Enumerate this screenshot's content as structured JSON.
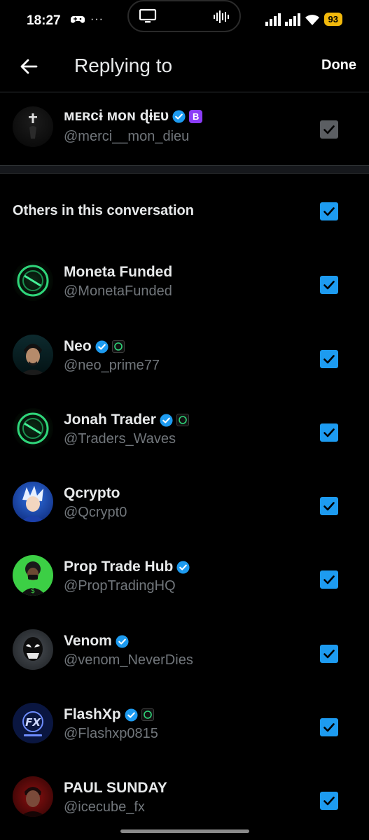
{
  "status_bar": {
    "time": "18:27",
    "dots": "···",
    "battery": "93"
  },
  "header": {
    "title": "Replying to",
    "done_label": "Done"
  },
  "primary": {
    "name": "ᴍᴇʀᴄɨ ᴍᴏɴ ɖɨᴇᴜ",
    "handle": "@merci__mon_dieu",
    "badge_letter": "B"
  },
  "section_label": "Others in this conversation",
  "users": [
    {
      "name": "Moneta Funded",
      "handle": "@MonetaFunded"
    },
    {
      "name": "Neo",
      "handle": "@neo_prime77"
    },
    {
      "name": "Jonah Trader",
      "handle": "@Traders_Waves"
    },
    {
      "name": "Qcrypto",
      "handle": "@Qcrypt0"
    },
    {
      "name": "Prop Trade Hub",
      "handle": "@PropTradingHQ"
    },
    {
      "name": "Venom",
      "handle": "@venom_NeverDies"
    },
    {
      "name": "FlashXp",
      "handle": "@Flashxp0815"
    },
    {
      "name": "PAUL SUNDAY",
      "handle": "@icecube_fx"
    }
  ],
  "colors": {
    "accent": "#1d9bf0",
    "background": "#000000",
    "secondary_text": "#71767b"
  }
}
